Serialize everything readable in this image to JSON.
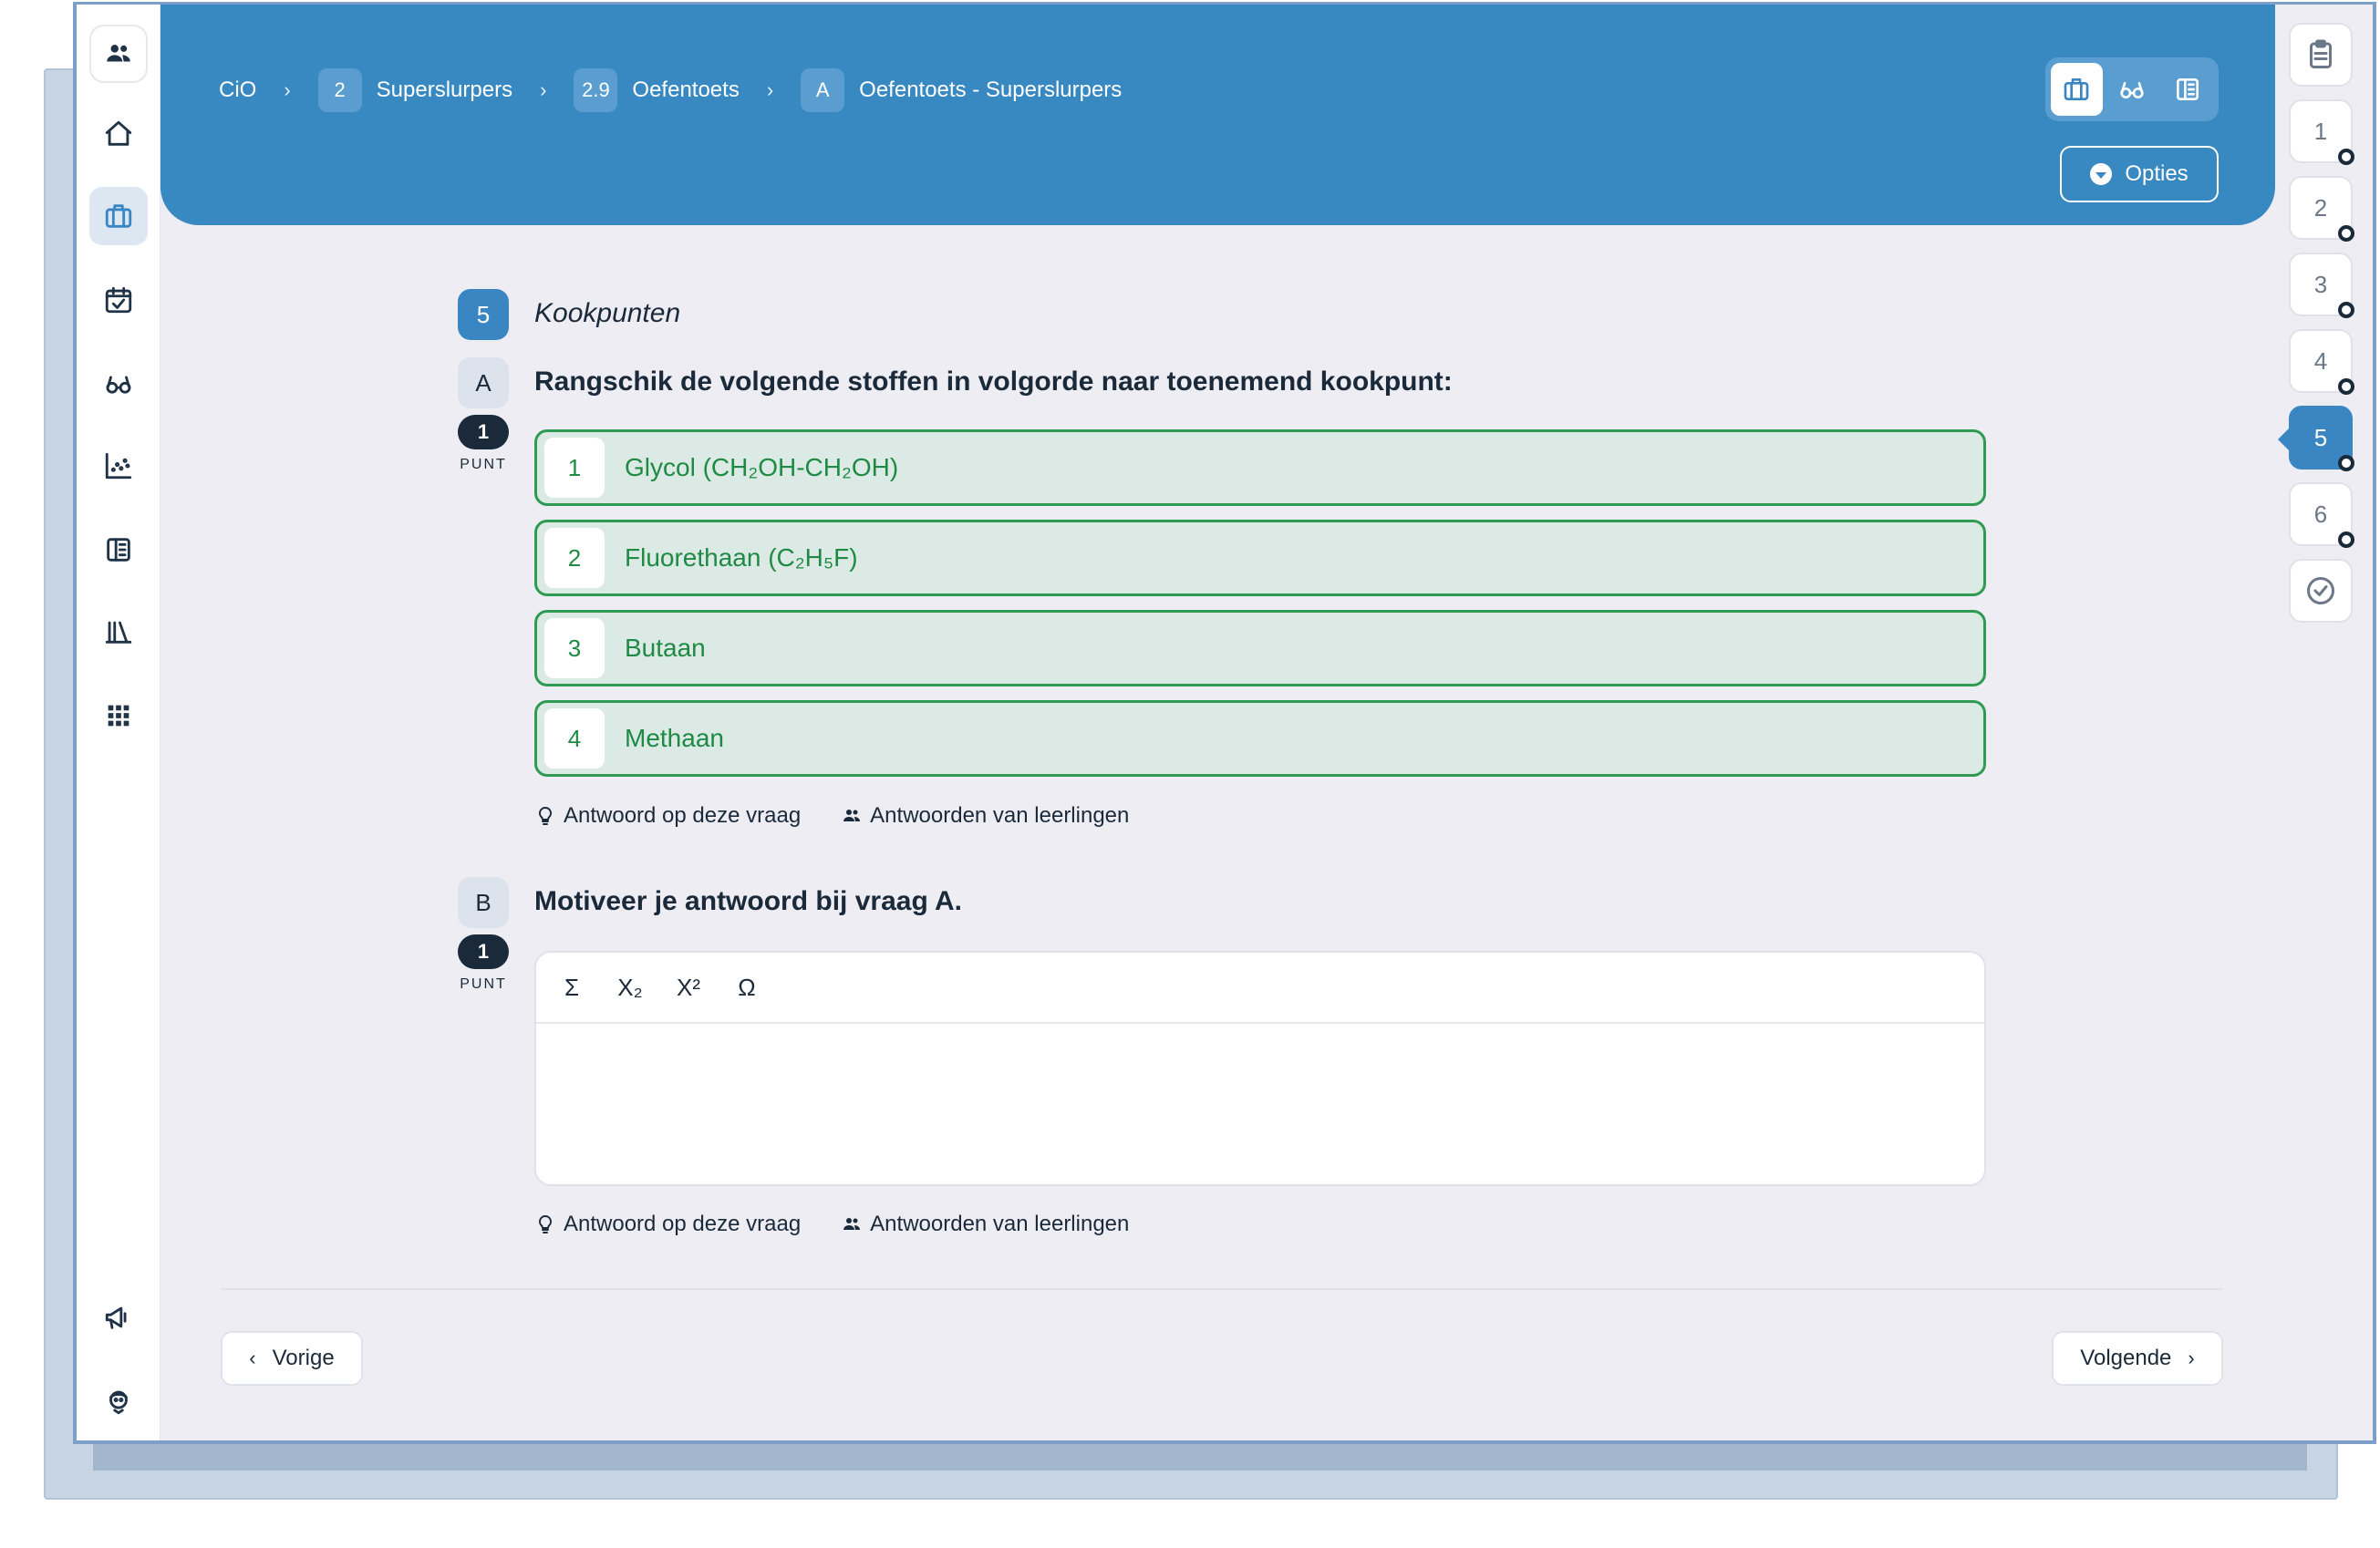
{
  "breadcrumb": {
    "root": "CiO",
    "items": [
      {
        "badge": "2",
        "label": "Superslurpers"
      },
      {
        "badge": "2.9",
        "label": "Oefentoets"
      },
      {
        "badge": "A",
        "label": "Oefentoets - Superslurpers"
      }
    ]
  },
  "header": {
    "options_label": "Opties",
    "mode_icons": [
      "briefcase-icon",
      "glasses-icon",
      "flask-book-icon"
    ]
  },
  "sidebar": {
    "icons": [
      "users-icon",
      "home-icon",
      "briefcase-icon",
      "calendar-check-icon",
      "glasses-icon",
      "chart-icon",
      "flask-book-icon",
      "library-icon",
      "apps-grid-icon",
      "megaphone-icon",
      "avatar-icon"
    ],
    "active": "briefcase-icon"
  },
  "rail": {
    "top_icon": "clipboard-icon",
    "questions": [
      "1",
      "2",
      "3",
      "4",
      "5",
      "6"
    ],
    "active": "5",
    "finish_icon": "check-circle-icon"
  },
  "question": {
    "number": "5",
    "title": "Kookpunten",
    "parts": [
      {
        "letter": "A",
        "text": "Rangschik de volgende stoffen in volgorde naar toenemend kookpunt:",
        "points": "1",
        "points_label": "PUNT",
        "answers": [
          {
            "num": "1",
            "text": "Glycol (CH₂OH-CH₂OH)"
          },
          {
            "num": "2",
            "text": "Fluorethaan (C₂H₅F)"
          },
          {
            "num": "3",
            "text": "Butaan"
          },
          {
            "num": "4",
            "text": "Methaan"
          }
        ]
      },
      {
        "letter": "B",
        "text": "Motiveer je antwoord bij vraag A.",
        "points": "1",
        "points_label": "PUNT",
        "toolbar": [
          "Σ",
          "X₂",
          "X²",
          "Ω"
        ]
      }
    ],
    "link_answer": "Antwoord op deze vraag",
    "link_students": "Antwoorden van leerlingen"
  },
  "nav": {
    "prev": "Vorige",
    "next": "Volgende"
  },
  "colors": {
    "header_blue": "#3888c1",
    "correct_green": "#2f9a52",
    "correct_bg": "#dbeae4",
    "dark": "#1b2a3a"
  }
}
